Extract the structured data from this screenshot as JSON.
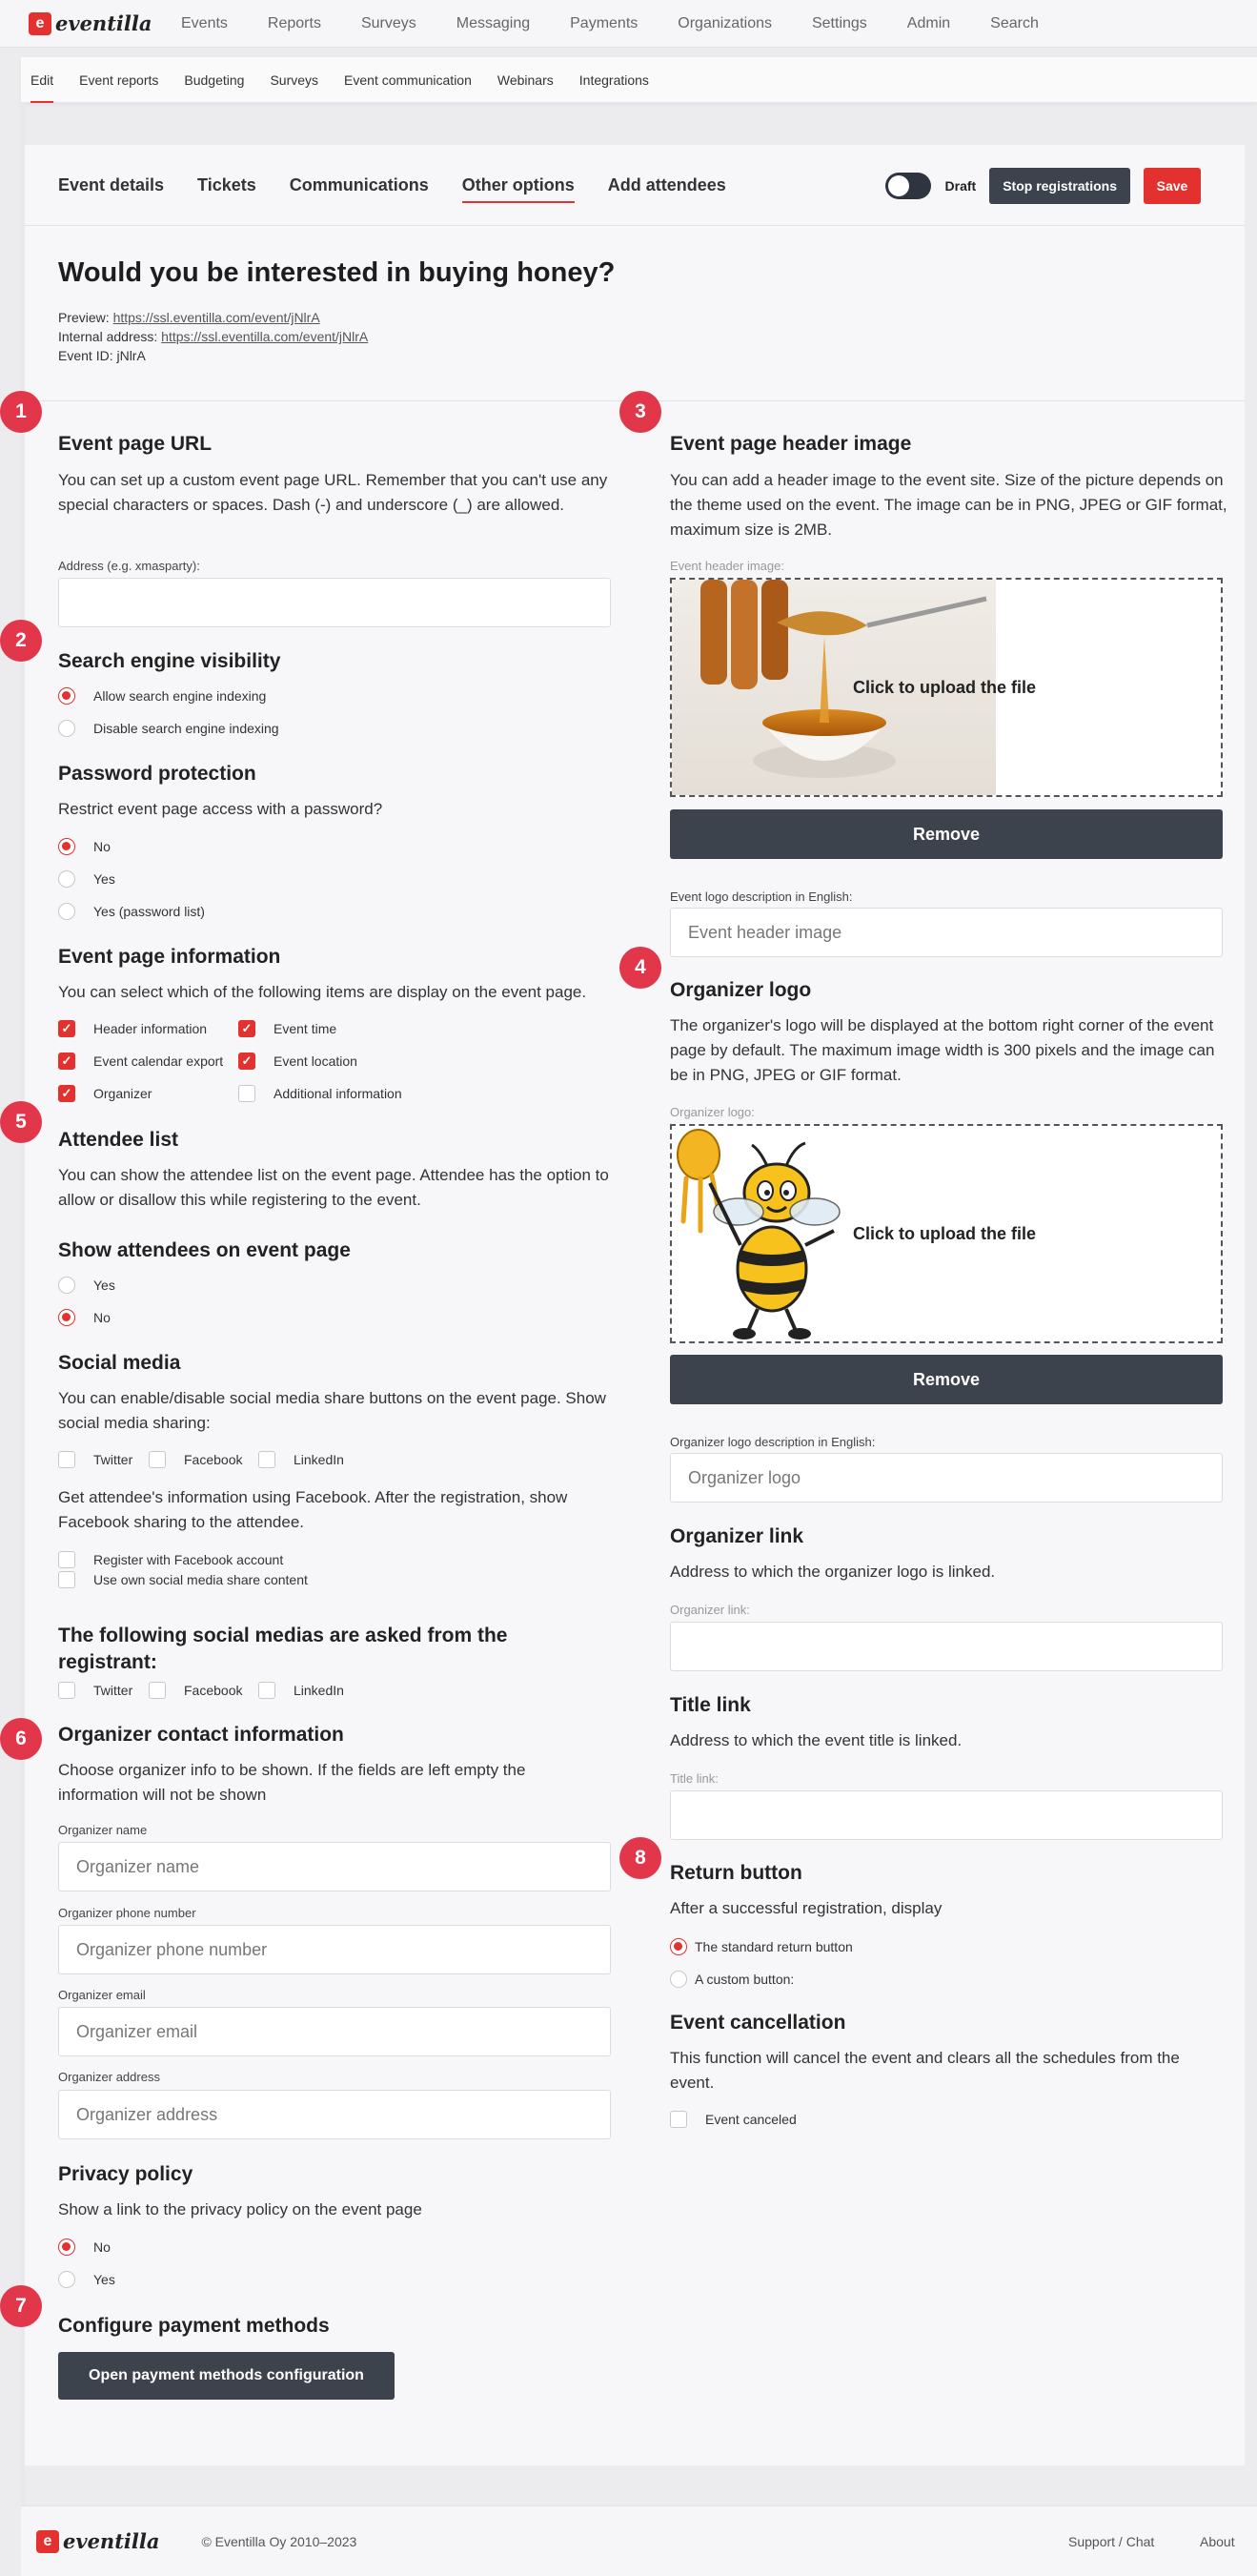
{
  "brand": {
    "name": "eventilla",
    "accent": "#e2312f",
    "dark_button": "#3d434d"
  },
  "topnav": [
    "Events",
    "Reports",
    "Surveys",
    "Messaging",
    "Payments",
    "Organizations",
    "Settings",
    "Admin",
    "Search"
  ],
  "subnav": [
    "Edit",
    "Event reports",
    "Budgeting",
    "Surveys",
    "Event communication",
    "Webinars",
    "Integrations"
  ],
  "tabs": [
    "Event details",
    "Tickets",
    "Communications",
    "Other options",
    "Add attendees"
  ],
  "toolbar": {
    "draft": "Draft",
    "stop": "Stop registrations",
    "save": "Save"
  },
  "event": {
    "title": "Would you be interested in buying honey?",
    "preview_label": "Preview: ",
    "preview_url": "https://ssl.eventilla.com/event/jNlrA",
    "internal_label": "Internal address: ",
    "internal_url": "https://ssl.eventilla.com/event/jNlrA",
    "id_text": "Event ID: jNlrA"
  },
  "badges": [
    "1",
    "2",
    "3",
    "4",
    "5",
    "6",
    "7",
    "8"
  ],
  "left": {
    "url_title": "Event page URL",
    "url_desc": "You can set up a custom event page URL. Remember that you can't use any special characters or spaces. Dash (-) and underscore (_) are allowed.",
    "url_label": "Address (e.g. xmasparty):",
    "seo_title": "Search engine visibility",
    "seo_allow": "Allow search engine indexing",
    "seo_disable": "Disable search engine indexing",
    "pw_title": "Password protection",
    "pw_desc": "Restrict event page access with a password?",
    "pw_no": "No",
    "pw_yes": "Yes",
    "pw_list": "Yes (password list)",
    "info_title": "Event page information",
    "info_desc": "You can select which of the following items are display on the event page.",
    "info_items": [
      "Header information",
      "Event time",
      "Event calendar export",
      "Event location",
      "Organizer",
      "Additional information"
    ],
    "att_title": "Attendee list",
    "att_desc": "You can show the attendee list on the event page. Attendee has the option to allow or disallow this while registering to the event.",
    "show_title": "Show attendees on event page",
    "show_yes": "Yes",
    "show_no": "No",
    "social_title": "Social media",
    "social_desc": "You can enable/disable social media share buttons on the event page. Show social media sharing:",
    "social_items": [
      "Twitter",
      "Facebook",
      "LinkedIn"
    ],
    "fb_desc": "Get attendee's information using Facebook. After the registration, show Facebook sharing to the attendee.",
    "fb_register": "Register with Facebook account",
    "fb_own": "Use own social media share content",
    "asked_title": "The following social medias are asked from the registrant:",
    "asked_items": [
      "Twitter",
      "Facebook",
      "LinkedIn"
    ],
    "contact_title": "Organizer contact information",
    "contact_desc": "Choose organizer info to be shown. If the fields are left empty the information will not be shown",
    "contact_fields": [
      {
        "label": "Organizer name",
        "placeholder": "Organizer name"
      },
      {
        "label": "Organizer phone number",
        "placeholder": "Organizer phone number"
      },
      {
        "label": "Organizer email",
        "placeholder": "Organizer email"
      },
      {
        "label": "Organizer address",
        "placeholder": "Organizer address"
      }
    ],
    "privacy_title": "Privacy policy",
    "privacy_desc": "Show a link to the privacy policy on the event page",
    "privacy_no": "No",
    "privacy_yes": "Yes",
    "pay_title": "Configure payment methods",
    "pay_button": "Open payment methods configuration"
  },
  "right": {
    "header_title": "Event page header image",
    "header_desc": "You can add a header image to the event site. Size of the picture depends on the theme used on the event. The image can be in PNG, JPEG or GIF format, maximum size is 2MB.",
    "header_label": "Event header image:",
    "upload_text": "Click to upload the file",
    "remove": "Remove",
    "header_desc_label": "Event logo description in English:",
    "header_desc_placeholder": "Event header image",
    "logo_title": "Organizer logo",
    "logo_desc": "The organizer's logo will be displayed at the bottom right corner of the event page by default. The maximum image width is 300 pixels and the image can be in PNG, JPEG or GIF format.",
    "logo_label": "Organizer logo:",
    "logo_desc_label": "Organizer logo description in English:",
    "logo_desc_placeholder": "Organizer logo",
    "orglink_title": "Organizer link",
    "orglink_desc": "Address to which the organizer logo is linked.",
    "orglink_label": "Organizer link:",
    "titlelink_title": "Title link",
    "titlelink_desc": "Address to which the event title is linked.",
    "titlelink_label": "Title link:",
    "return_title": "Return button",
    "return_desc": "After a successful registration, display",
    "return_standard": "The standard return button",
    "return_custom": "A custom button:",
    "cancel_title": "Event cancellation",
    "cancel_desc": "This function will cancel the event and clears all the schedules from the event.",
    "cancel_check": "Event canceled"
  },
  "footer": {
    "copy": "© Eventilla Oy 2010–2023",
    "support": "Support / Chat",
    "about": "About"
  }
}
